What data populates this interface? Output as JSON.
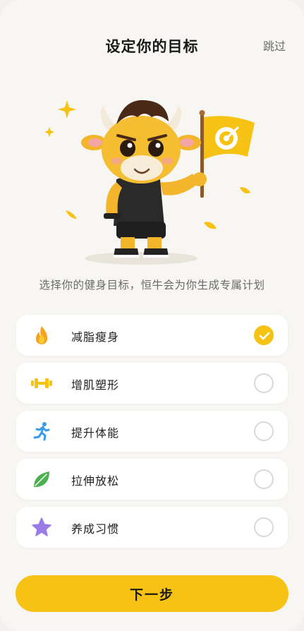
{
  "header": {
    "title": "设定你的目标",
    "skip_label": "跳过"
  },
  "hero": {
    "mascot": "bull-mascot-with-target-flag"
  },
  "subtitle": "选择你的健身目标，恒牛会为你生成专属计划",
  "goals": [
    {
      "label": "减脂瘦身",
      "icon": "flame-icon",
      "selected": true
    },
    {
      "label": "增肌塑形",
      "icon": "dumbbell-icon",
      "selected": false
    },
    {
      "label": "提升体能",
      "icon": "running-icon",
      "selected": false
    },
    {
      "label": "拉伸放松",
      "icon": "leaf-icon",
      "selected": false
    },
    {
      "label": "养成习惯",
      "icon": "star-icon",
      "selected": false
    }
  ],
  "next_label": "下一步",
  "colors": {
    "accent": "#f6c315",
    "background": "#f7f6f3"
  }
}
